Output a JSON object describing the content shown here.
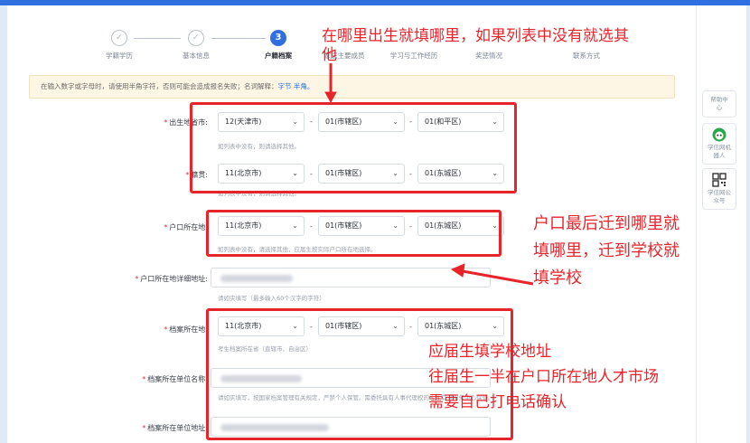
{
  "steps": [
    {
      "label": "学籍学历",
      "mark": "✓",
      "state": "done"
    },
    {
      "label": "基本信息",
      "mark": "✓",
      "state": "done"
    },
    {
      "label": "户籍档案",
      "mark": "3",
      "state": "active"
    },
    {
      "label": "家庭主要成员",
      "mark": "",
      "state": "todo"
    },
    {
      "label": "学习与工作经历",
      "mark": "",
      "state": "todo"
    },
    {
      "label": "奖惩情况",
      "mark": "",
      "state": "todo"
    },
    {
      "label": "联系方式",
      "mark": "",
      "state": "todo"
    }
  ],
  "notice": {
    "text": "在输入数字或字母时，请使用半角字符，否则可能会造成报名失败；名词解释：",
    "link": "字节 半角。"
  },
  "fields": {
    "birthplace": {
      "label": "出生地省市:",
      "province": "12(天津市)",
      "city": "01(市辖区)",
      "district": "01(和平区)",
      "hint": "如列表中没有，则请选择其他。"
    },
    "native": {
      "label": "籍贯:",
      "province": "11(北京市)",
      "city": "01(市辖区)",
      "district": "01(东城区)",
      "hint": "如列表中没有，则请选择其他。"
    },
    "hukou": {
      "label": "户口所在地:",
      "province": "11(北京市)",
      "city": "01(市辖区)",
      "district": "01(东城区)",
      "hint": "如列表中没有，请选择其他，应届生按实际户口所在地选择。"
    },
    "hukou_detail": {
      "label": "户口所在地详细地址:",
      "hint": "请如实填写（最多输入60个汉字的字符）"
    },
    "archive": {
      "label": "档案所在地:",
      "province": "11(北京市)",
      "city": "01(市辖区)",
      "district": "01(东城区)",
      "hint": "考生档案所在省（直辖市、自治区）"
    },
    "archive_unit": {
      "label": "档案所在单位名称:",
      "hint": "请如实填写，按国家档案管理有关规定，严禁个人保管。需委托具有人事代理权的人才交流服务中心保管。"
    },
    "archive_address": {
      "label": "档案所在单位地址:"
    }
  },
  "sidebar": {
    "help": "帮助中心",
    "robot": "学信网机器人",
    "official": "学信网公众号"
  },
  "annotations": {
    "birth_line1": "在哪里出生就填哪里，如果列表中没有就选其",
    "birth_line2": "他",
    "hukou_line1": "户口最后迁到哪里就",
    "hukou_line2": "填哪里，迁到学校就",
    "hukou_line3": "填学校",
    "archive_line1": "应届生填学校地址",
    "archive_line2": "往届生一半在户口所在地人才市场",
    "archive_line3": "需要自己打电话确认"
  },
  "colors": {
    "accent": "#2f6fe0",
    "annotation": "#e8242b",
    "required": "#e0303a"
  }
}
